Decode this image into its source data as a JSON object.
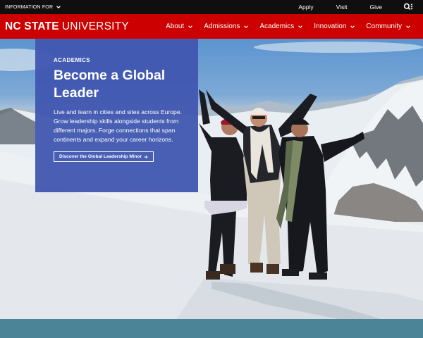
{
  "utility": {
    "info_for": "INFORMATION FOR",
    "links": [
      "Apply",
      "Visit",
      "Give"
    ]
  },
  "brand": {
    "logo_bold": "NC STATE",
    "logo_light": "UNIVERSITY",
    "nav": [
      "About",
      "Admissions",
      "Academics",
      "Innovation",
      "Community"
    ]
  },
  "hero": {
    "eyebrow": "ACADEMICS",
    "title_line1": "Become a Global",
    "title_line2": "Leader",
    "description": "Live and learn in cities and sites across Europe. Grow leadership skills alongside students from different majors. Forge connections that span continents and expand your career horizons.",
    "cta": "Discover the Global Leadership Minor"
  },
  "colors": {
    "brand_red": "#cc0000",
    "utility_black": "#0f0f0f",
    "panel_blue": "#4056b0",
    "band_teal": "#4a8496"
  },
  "icons": {
    "info_for": "chevron-down-icon",
    "nav": "chevron-down-icon",
    "search": "search-menu-icon",
    "cta": "arrow-right-icon"
  }
}
